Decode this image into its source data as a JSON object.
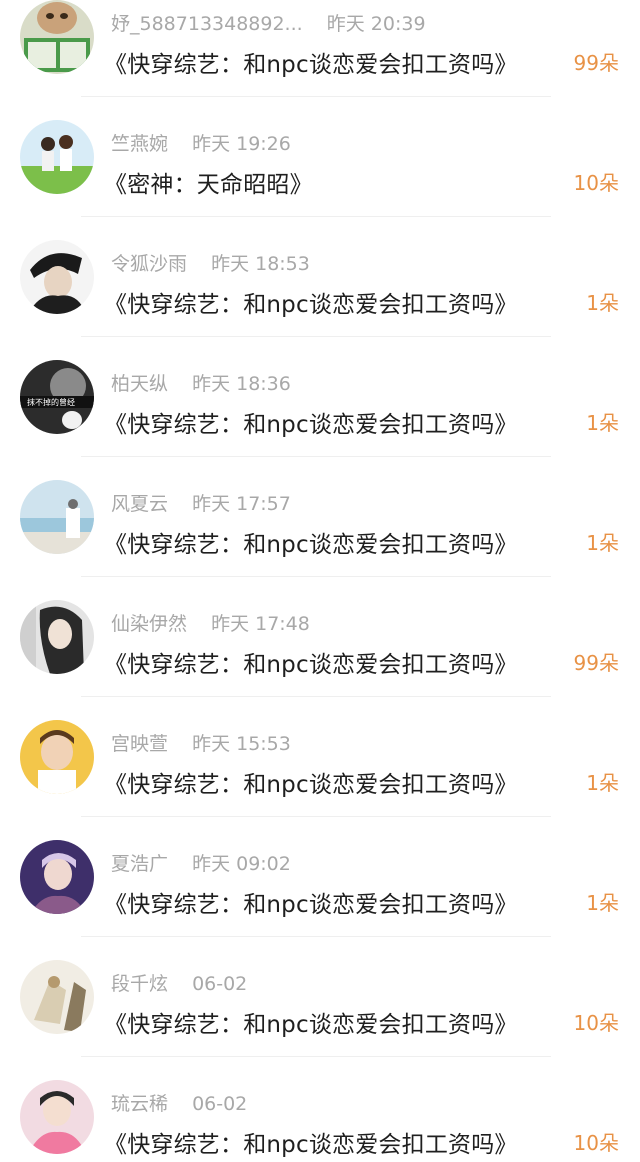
{
  "colors": {
    "name_time": "#a8a8a8",
    "title": "#1f1f1f",
    "count": "#e89246",
    "divider": "#efefef"
  },
  "rows": [
    {
      "name": "妤_588713348892...",
      "time": "昨天 20:39",
      "title": "《快穿综艺：和npc谈恋爱会扣工资吗》",
      "count": "99朵",
      "avatar": "dog-reading-avatar"
    },
    {
      "name": "竺燕婉",
      "time": "昨天 19:26",
      "title": "《密神：天命昭昭》",
      "count": "10朵",
      "avatar": "couple-grass-avatar"
    },
    {
      "name": "令狐沙雨",
      "time": "昨天 18:53",
      "title": "《快穿综艺：和npc谈恋爱会扣工资吗》",
      "count": "1朵",
      "avatar": "man-anime-avatar"
    },
    {
      "name": "柏天纵",
      "time": "昨天 18:36",
      "title": "《快穿综艺：和npc谈恋爱会扣工资吗》",
      "count": "1朵",
      "avatar": "bw-text-avatar"
    },
    {
      "name": "风夏云",
      "time": "昨天 17:57",
      "title": "《快穿综艺：和npc谈恋爱会扣工资吗》",
      "count": "1朵",
      "avatar": "beach-avatar"
    },
    {
      "name": "仙染伊然",
      "time": "昨天 17:48",
      "title": "《快穿综艺：和npc谈恋爱会扣工资吗》",
      "count": "99朵",
      "avatar": "girl-hair-avatar"
    },
    {
      "name": "宫映萱",
      "time": "昨天 15:53",
      "title": "《快穿综艺：和npc谈恋爱会扣工资吗》",
      "count": "1朵",
      "avatar": "child-avatar"
    },
    {
      "name": "夏浩广",
      "time": "昨天 09:02",
      "title": "《快穿综艺：和npc谈恋爱会扣工资吗》",
      "count": "1朵",
      "avatar": "boy-purple-avatar"
    },
    {
      "name": "段千炫",
      "time": "06-02",
      "title": "《快穿综艺：和npc谈恋爱会扣工资吗》",
      "count": "10朵",
      "avatar": "drawing-avatar"
    },
    {
      "name": "琉云稀",
      "time": "06-02",
      "title": "《快穿综艺：和npc谈恋爱会扣工资吗》",
      "count": "10朵",
      "avatar": "pink-boy-avatar"
    }
  ],
  "avatar_label_bw": "抹不掉的曾经"
}
